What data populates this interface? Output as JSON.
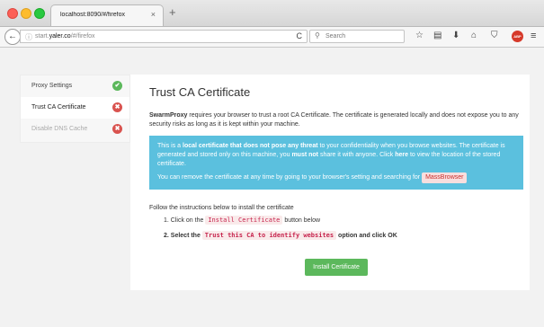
{
  "browser": {
    "tab_title": "localhost:8090/#/firefox",
    "tab_close": "×",
    "new_tab": "+",
    "back": "←",
    "url_prefix": "start.",
    "url_domain": "yaler.co",
    "url_path": "/#/firefox",
    "reload": "C",
    "search_placeholder": "Search",
    "abp_label": "ABP"
  },
  "sidebar": {
    "items": [
      {
        "label": "Proxy Settings",
        "status": "ok",
        "glyph": "✔"
      },
      {
        "label": "Trust CA Certificate",
        "status": "error",
        "glyph": "✖"
      },
      {
        "label": "Disable DNS Cache",
        "status": "error",
        "glyph": "✖"
      }
    ]
  },
  "main": {
    "title": "Trust CA Certificate",
    "intro_brand": "SwarmProxy",
    "intro_text": " requires your browser to trust a root CA Certificate. The certificate is generated locally and does not expose you to any security risks as long as it is kept within your machine.",
    "alert": {
      "p1_a": "This is a ",
      "p1_b": "local certificate that does not pose any threat",
      "p1_c": " to your confidentiality when you browse websites. The certificate is generated and stored only on this machine, you ",
      "p1_d": "must not",
      "p1_e": " share it with anyone. Click ",
      "p1_f": "here",
      "p1_g": " to view the location of the stored certificate.",
      "p2_a": "You can remove the certificate at any time by going to your browser's setting and searching for ",
      "p2_badge": "MassBrowser"
    },
    "instructions": "Follow the instructions below to install the certificate",
    "step1_a": "1. Click on the ",
    "step1_code": "Install Certificate",
    "step1_b": " button below",
    "step2_a": "2. Select the ",
    "step2_code": "Trust this CA to identify websites",
    "step2_b": " option and click OK",
    "install_button": "Install Certificate"
  },
  "colors": {
    "accent_green": "#5cb85c",
    "error_red": "#d9534f",
    "info_blue": "#5bc0de"
  }
}
